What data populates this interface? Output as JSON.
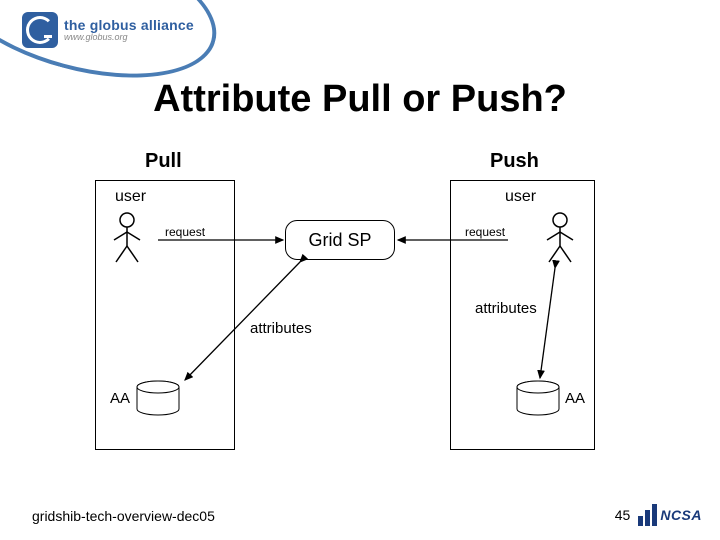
{
  "logo": {
    "title": "the globus alliance",
    "url": "www.globus.org"
  },
  "title": "Attribute Pull or Push?",
  "columns": {
    "left": "Pull",
    "right": "Push"
  },
  "labels": {
    "user_left": "user",
    "user_right": "user",
    "request_left": "request",
    "request_right": "request",
    "grid_sp": "Grid SP",
    "attributes_left": "attributes",
    "attributes_right": "attributes",
    "aa_left": "AA",
    "aa_right": "AA"
  },
  "footer": {
    "doc_id": "gridshib-tech-overview-dec05",
    "page_num": "45",
    "ncsa": "NCSA"
  }
}
